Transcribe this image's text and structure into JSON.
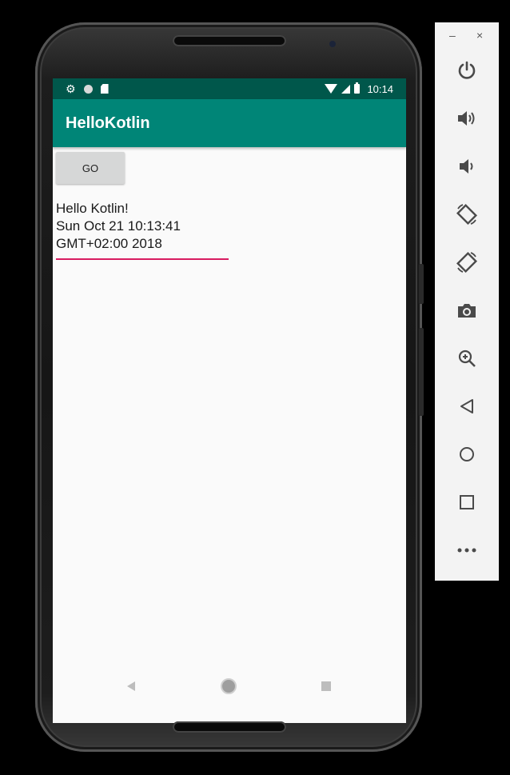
{
  "status_bar": {
    "time": "10:14",
    "icons": [
      "gear-icon",
      "circle-icon",
      "sd-card-icon",
      "wifi-icon",
      "signal-icon",
      "battery-icon"
    ]
  },
  "app_bar": {
    "title": "HelloKotlin"
  },
  "main": {
    "go_button_label": "GO",
    "result_lines": [
      "Hello Kotlin!",
      "Sun Oct 21 10:13:41",
      "GMT+02:00 2018"
    ]
  },
  "colors": {
    "status_bar": "#00574b",
    "app_bar": "#008577",
    "accent_underline": "#d81b60",
    "screen_background": "#fafafa"
  },
  "nav_bar": {
    "icons": [
      "back-icon",
      "home-icon",
      "recents-icon"
    ]
  },
  "emulator_panel": {
    "window_controls": [
      "–",
      "×"
    ],
    "tools": [
      "power-icon",
      "volume-up-icon",
      "volume-down-icon",
      "rotate-left-icon",
      "rotate-right-icon",
      "camera-icon",
      "zoom-icon",
      "back-icon",
      "home-icon",
      "overview-icon",
      "more-icon"
    ]
  }
}
